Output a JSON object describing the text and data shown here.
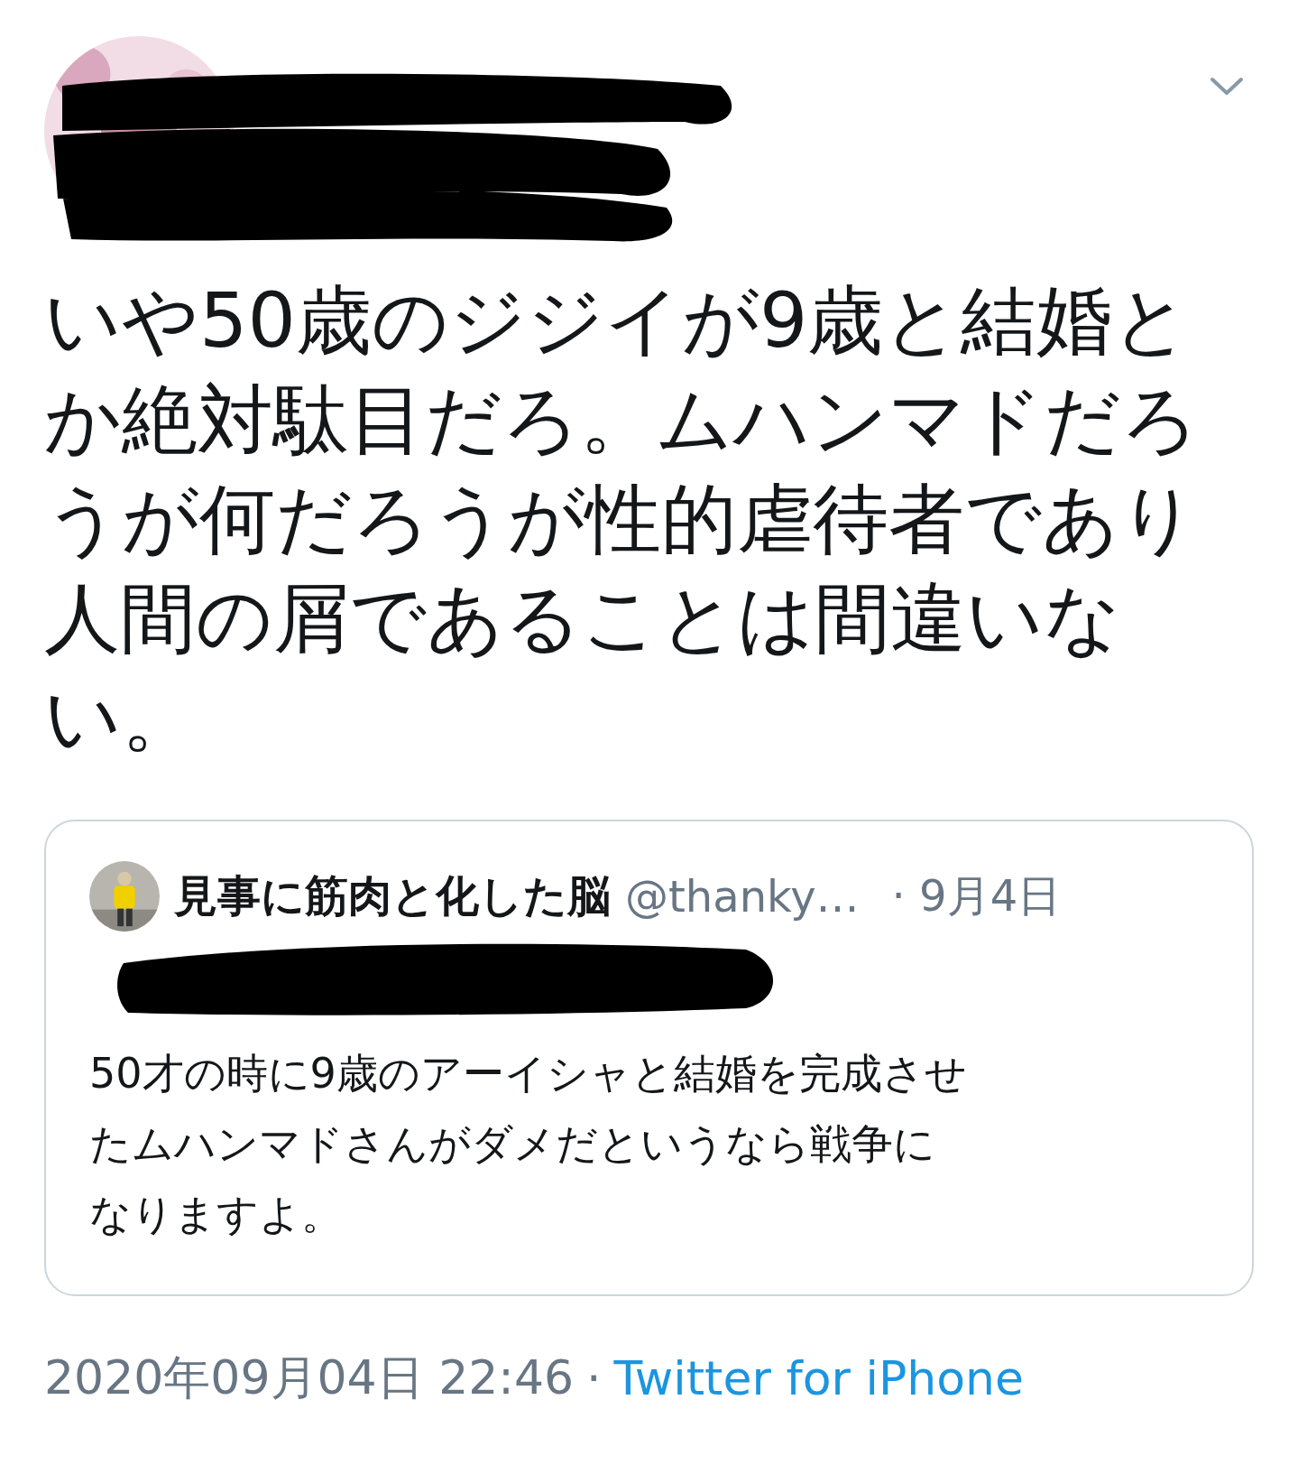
{
  "tweet": {
    "text_lines": [
      "いや50歳のジジイが9歳と結婚と",
      "か絶対駄目だろ。ムハンマドだろ",
      "うが何だろうが性的虐待者であり",
      "人間の屑であることは間違いな",
      "い。"
    ]
  },
  "quoted_tweet": {
    "name": "見事に筋肉と化した脳",
    "handle": "@thanky…",
    "date": "· 9月4日",
    "text_lines": [
      "50才の時に9歳のアーイシャと結婚を完成させ",
      "たムハンマドさんがダメだというなら戦争に",
      "なりますよ。"
    ]
  },
  "footer": {
    "timestamp": "2020年09月04日 22:46",
    "separator": "·",
    "source": "Twitter for iPhone"
  }
}
